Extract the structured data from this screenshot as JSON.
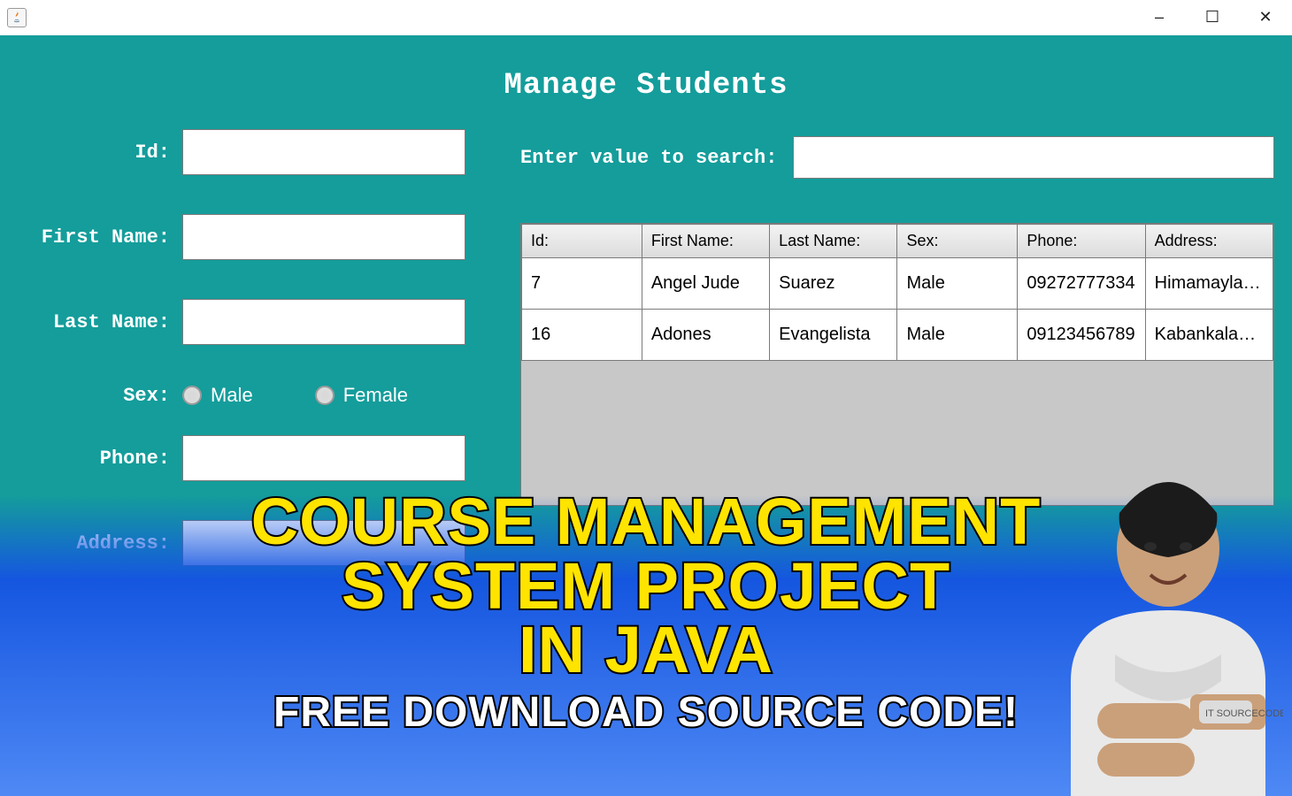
{
  "window": {
    "minimize": "–",
    "maximize": "☐",
    "close": "✕"
  },
  "app": {
    "title": "Manage Students"
  },
  "form": {
    "id_label": "Id:",
    "first_name_label": "First Name:",
    "last_name_label": "Last Name:",
    "sex_label": "Sex:",
    "phone_label": "Phone:",
    "address_label": "Address:",
    "male_label": "Male",
    "female_label": "Female"
  },
  "search": {
    "label": "Enter value to search:",
    "value": ""
  },
  "table": {
    "headers": {
      "id": "Id:",
      "first_name": "First Name:",
      "last_name": "Last Name:",
      "sex": "Sex:",
      "phone": "Phone:",
      "address": "Address:"
    },
    "rows": [
      {
        "id": "7",
        "first_name": "Angel Jude",
        "last_name": "Suarez",
        "sex": "Male",
        "phone": "09272777334",
        "address": "Himamaylan ..."
      },
      {
        "id": "16",
        "first_name": "Adones",
        "last_name": "Evangelista",
        "sex": "Male",
        "phone": "09123456789",
        "address": "Kabankalan C..."
      }
    ]
  },
  "overlay": {
    "line1": "COURSE MANAGEMENT",
    "line2": "SYSTEM PROJECT",
    "line3": "IN JAVA",
    "subtitle": "FREE DOWNLOAD SOURCE CODE!"
  },
  "colors": {
    "teal": "#149d9b",
    "blue_gradient_top": "#1556e0",
    "blue_gradient_bottom": "#4f89f5",
    "title_yellow": "#ffe400"
  }
}
